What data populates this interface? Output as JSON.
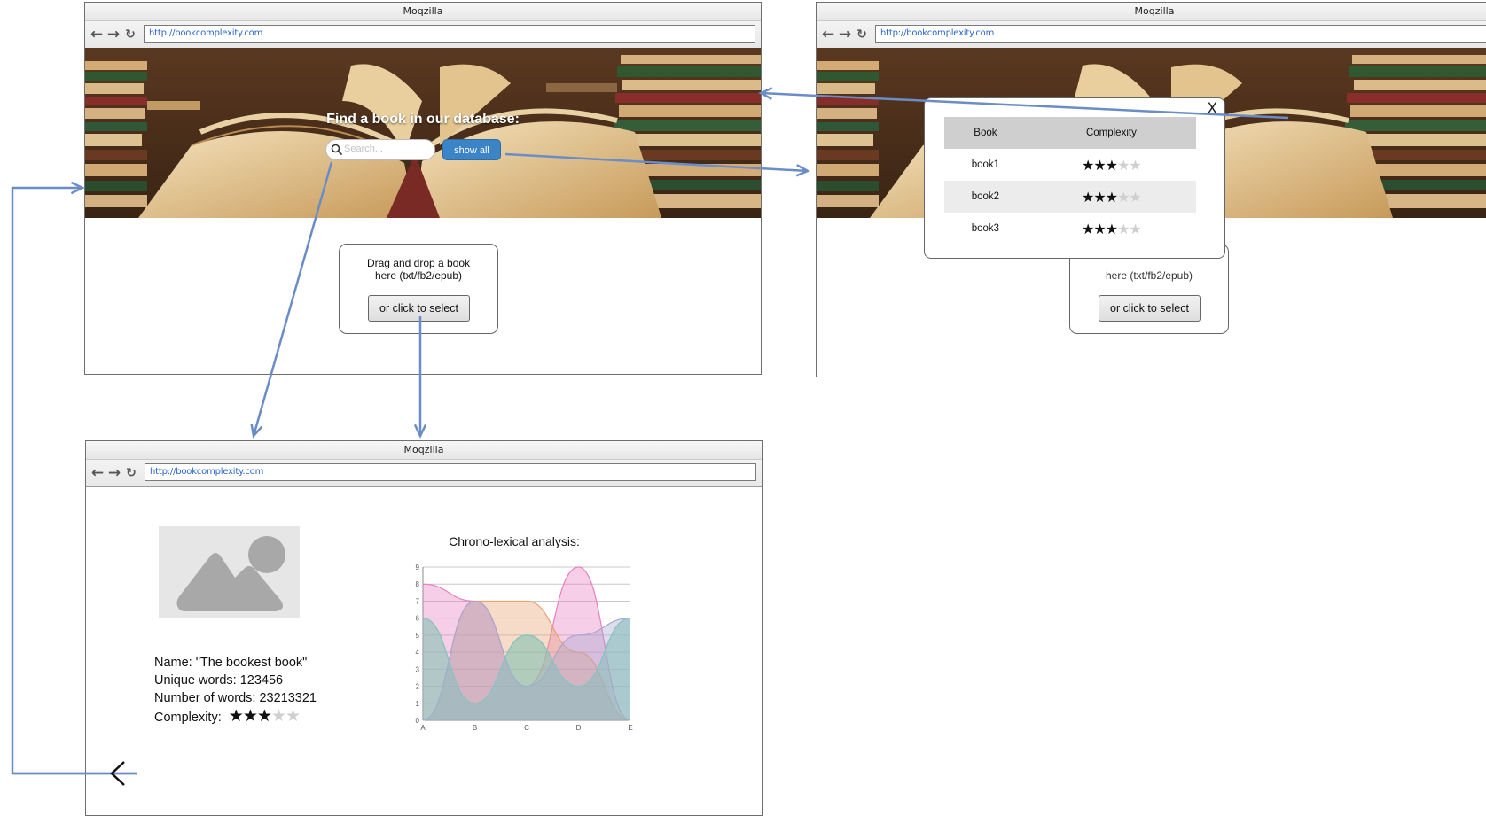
{
  "colors": {
    "connector": "#6a8cc7",
    "accent": "#3b84c8"
  },
  "browser_a": {
    "title": "Moqzilla",
    "url": "http://bookcomplexity.com",
    "nav": {
      "back_icon": "←",
      "forward_icon": "→",
      "reload_icon": "↻"
    },
    "hero_title": "Find a book in our database:",
    "search_placeholder": "Search...",
    "show_all_label": "show all",
    "drop_text": "Drag and drop a book here (txt/fb2/epub)",
    "select_label": "or click to select"
  },
  "browser_b": {
    "title": "Moqzilla",
    "url": "http://bookcomplexity.com",
    "drop_text_partial": "here (txt/fb2/epub)",
    "select_label": "or click to select",
    "modal": {
      "close_icon": "X",
      "col_book": "Book",
      "col_complexity": "Complexity",
      "rows": [
        {
          "book": "book1",
          "stars": 3,
          "max": 5
        },
        {
          "book": "book2",
          "stars": 3,
          "max": 5
        },
        {
          "book": "book3",
          "stars": 3,
          "max": 5
        }
      ]
    }
  },
  "browser_c": {
    "title": "Moqzilla",
    "url": "http://bookcomplexity.com",
    "chart_title": "Chrono-lexical analysis:",
    "details": {
      "name": "Name: \"The bookest book\"",
      "unique": "Unique words: 123456",
      "words": "Number of words: 23213321",
      "complexity_label": "Complexity:",
      "complexity_stars": 3,
      "complexity_max": 5
    }
  },
  "chart_data": {
    "type": "area",
    "title": "Chrono-lexical analysis:",
    "categories": [
      "A",
      "B",
      "C",
      "D",
      "E"
    ],
    "ylim": [
      0,
      9
    ],
    "yticks": [
      0,
      1,
      2,
      3,
      4,
      5,
      6,
      7,
      8,
      9
    ],
    "grid": true,
    "series": [
      {
        "color": "#e87fc0",
        "values": [
          8,
          7,
          2,
          9,
          0
        ]
      },
      {
        "color": "#e8a070",
        "values": [
          0,
          7,
          7,
          4,
          0
        ]
      },
      {
        "color": "#8fbf9c",
        "values": [
          6,
          1,
          5,
          2,
          6
        ]
      },
      {
        "color": "#a6a6d0",
        "values": [
          0,
          7,
          2,
          5,
          6
        ]
      },
      {
        "color": "#86c4c4",
        "values": [
          6,
          1,
          5,
          2,
          6
        ]
      }
    ]
  }
}
